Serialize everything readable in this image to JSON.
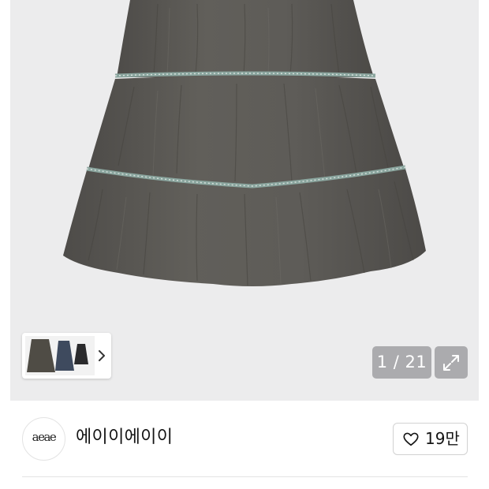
{
  "gallery": {
    "photo_alt": "Grey tiered skirt with lace trim",
    "counter": "1 / 21",
    "thumbnail_alt": "Skirt color options"
  },
  "seller": {
    "logo_text": "aeae",
    "name": "에이이에이이",
    "likes": "19만"
  },
  "colors": {
    "photo_background": "#ececed",
    "skirt": "#5b5955",
    "trim": "#8aa59e",
    "overlay": "#969698"
  },
  "icons": {
    "next": "chevron-right-icon",
    "expand": "expand-arrows-icon",
    "like": "heart-outline-icon"
  }
}
